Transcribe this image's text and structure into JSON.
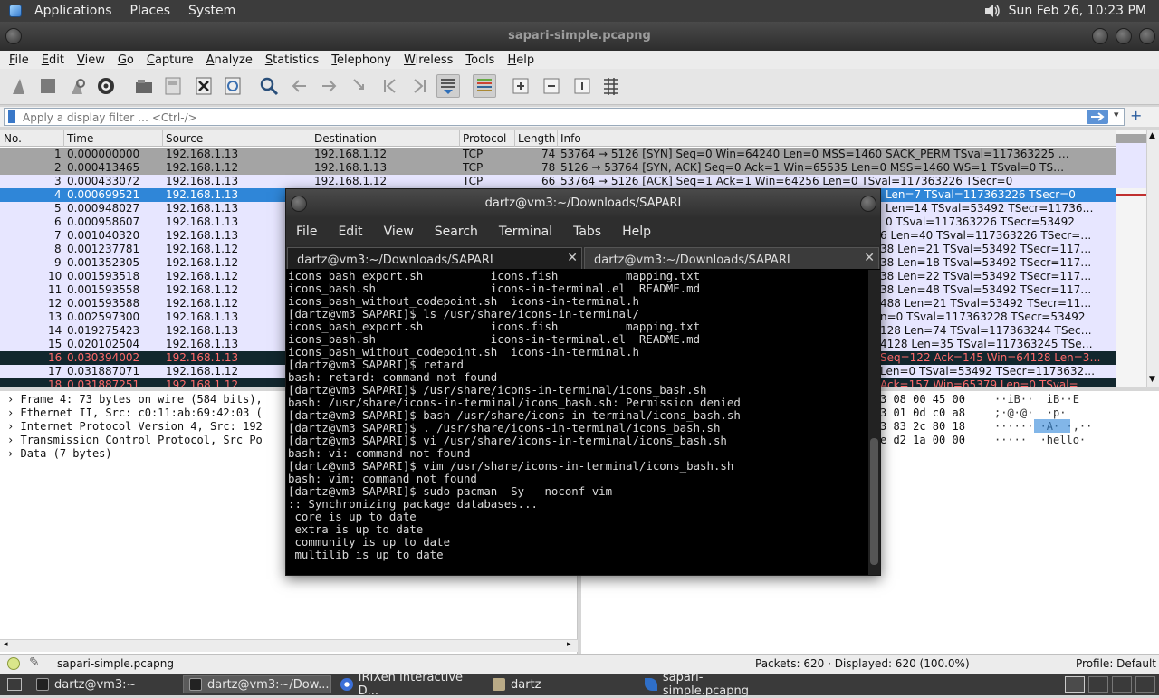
{
  "top_panel": {
    "menus": [
      "Applications",
      "Places",
      "System"
    ],
    "clock": "Sun Feb 26, 10:23 PM"
  },
  "wireshark": {
    "title": "sapari-simple.pcapng",
    "menus": [
      "File",
      "Edit",
      "View",
      "Go",
      "Capture",
      "Analyze",
      "Statistics",
      "Telephony",
      "Wireless",
      "Tools",
      "Help"
    ],
    "filter_placeholder": "Apply a display filter … <Ctrl-/>",
    "columns": [
      "No.",
      "Time",
      "Source",
      "Destination",
      "Protocol",
      "Length",
      "Info"
    ],
    "packets": [
      {
        "no": "1",
        "time": "0.000000000",
        "src": "192.168.1.13",
        "dst": "192.168.1.12",
        "proto": "TCP",
        "len": "74",
        "info": "53764 → 5126 [SYN] Seq=0 Win=64240 Len=0 MSS=1460 SACK_PERM TSval=117363225 …"
      },
      {
        "no": "2",
        "time": "0.000413465",
        "src": "192.168.1.12",
        "dst": "192.168.1.13",
        "proto": "TCP",
        "len": "78",
        "info": "5126 → 53764 [SYN, ACK] Seq=0 Ack=1 Win=65535 Len=0 MSS=1460 WS=1 TSval=0 TS…"
      },
      {
        "no": "3",
        "time": "0.000433072",
        "src": "192.168.1.13",
        "dst": "192.168.1.12",
        "proto": "TCP",
        "len": "66",
        "info": "53764 → 5126 [ACK] Seq=1 Ack=1 Win=64256 Len=0 TSval=117363226 TSecr=0"
      },
      {
        "no": "4",
        "time": "0.000699521",
        "src": "192.168.1.13",
        "dst": "",
        "proto": "",
        "len": "",
        "info": "Len=7 TSval=117363226 TSecr=0"
      },
      {
        "no": "5",
        "time": "0.000948027",
        "src": "192.168.1.13",
        "dst": "",
        "proto": "",
        "len": "",
        "info": "Len=14 TSval=53492 TSecr=11736…"
      },
      {
        "no": "6",
        "time": "0.000958607",
        "src": "192.168.1.13",
        "dst": "",
        "proto": "",
        "len": "",
        "info": "0 TSval=117363226 TSecr=53492"
      },
      {
        "no": "7",
        "time": "0.001040320",
        "src": "192.168.1.13",
        "dst": "",
        "proto": "",
        "len": "",
        "info": "6 Len=40 TSval=117363226 TSecr=…"
      },
      {
        "no": "8",
        "time": "0.001237781",
        "src": "192.168.1.12",
        "dst": "",
        "proto": "",
        "len": "",
        "info": "38 Len=21 TSval=53492 TSecr=117…"
      },
      {
        "no": "9",
        "time": "0.001352305",
        "src": "192.168.1.12",
        "dst": "",
        "proto": "",
        "len": "",
        "info": "38 Len=18 TSval=53492 TSecr=117…"
      },
      {
        "no": "10",
        "time": "0.001593518",
        "src": "192.168.1.12",
        "dst": "",
        "proto": "",
        "len": "",
        "info": "38 Len=22 TSval=53492 TSecr=117…"
      },
      {
        "no": "11",
        "time": "0.001593558",
        "src": "192.168.1.12",
        "dst": "",
        "proto": "",
        "len": "",
        "info": "38 Len=48 TSval=53492 TSecr=117…"
      },
      {
        "no": "12",
        "time": "0.001593588",
        "src": "192.168.1.12",
        "dst": "",
        "proto": "",
        "len": "",
        "info": "488 Len=21 TSval=53492 TSecr=11…"
      },
      {
        "no": "13",
        "time": "0.002597300",
        "src": "192.168.1.13",
        "dst": "",
        "proto": "",
        "len": "",
        "info": "n=0 TSval=117363228 TSecr=53492"
      },
      {
        "no": "14",
        "time": "0.019275423",
        "src": "192.168.1.13",
        "dst": "",
        "proto": "",
        "len": "",
        "info": "128 Len=74 TSval=117363244 TSec…"
      },
      {
        "no": "15",
        "time": "0.020102504",
        "src": "192.168.1.13",
        "dst": "",
        "proto": "",
        "len": "",
        "info": "4128 Len=35 TSval=117363245 TSe…"
      },
      {
        "no": "16",
        "time": "0.030394002",
        "src": "192.168.1.13",
        "dst": "",
        "proto": "",
        "len": "",
        "info": "Seq=122 Ack=145 Win=64128 Len=3…"
      },
      {
        "no": "17",
        "time": "0.031887071",
        "src": "192.168.1.12",
        "dst": "",
        "proto": "",
        "len": "",
        "info": "Len=0 TSval=53492 TSecr=1173632…"
      },
      {
        "no": "18",
        "time": "0.031887251",
        "src": "192.168.1.12",
        "dst": "",
        "proto": "",
        "len": "",
        "info": "Ack=157 Win=65379 Len=0 TSval=…"
      }
    ],
    "details": [
      "Frame 4: 73 bytes on wire (584 bits),",
      "Ethernet II, Src: c0:11:ab:69:42:03 (",
      "Internet Protocol Version 4, Src: 192",
      "Transmission Control Protocol, Src Po",
      "Data (7 bytes)"
    ],
    "bytes_hex": [
      "3 08 00 45 00",
      "3 01 0d c0 a8",
      "3 83 2c 80 18",
      "e d2 1a 00 00"
    ],
    "bytes_ascii": [
      "··iB··  iB··E",
      ";·@·@·  ·p·",
      "······ ·A· ·,··",
      "·····  ·hello·"
    ],
    "status_file": "sapari-simple.pcapng",
    "status_packets": "Packets: 620 · Displayed: 620 (100.0%)",
    "status_profile": "Profile: Default"
  },
  "terminal": {
    "title": "dartz@vm3:~/Downloads/SAPARI",
    "menus": [
      "File",
      "Edit",
      "View",
      "Search",
      "Terminal",
      "Tabs",
      "Help"
    ],
    "tabs": [
      "dartz@vm3:~/Downloads/SAPARI",
      "dartz@vm3:~/Downloads/SAPARI"
    ],
    "lines": [
      "icons_bash_export.sh          icons.fish          mapping.txt",
      "icons_bash.sh                 icons-in-terminal.el  README.md",
      "icons_bash_without_codepoint.sh  icons-in-terminal.h",
      "[dartz@vm3 SAPARI]$ ls /usr/share/icons-in-terminal/",
      "icons_bash_export.sh          icons.fish          mapping.txt",
      "icons_bash.sh                 icons-in-terminal.el  README.md",
      "icons_bash_without_codepoint.sh  icons-in-terminal.h",
      "[dartz@vm3 SAPARI]$ retard",
      "bash: retard: command not found",
      "[dartz@vm3 SAPARI]$ /usr/share/icons-in-terminal/icons_bash.sh",
      "bash: /usr/share/icons-in-terminal/icons_bash.sh: Permission denied",
      "[dartz@vm3 SAPARI]$ bash /usr/share/icons-in-terminal/icons_bash.sh",
      "[dartz@vm3 SAPARI]$ . /usr/share/icons-in-terminal/icons_bash.sh",
      "[dartz@vm3 SAPARI]$ vi /usr/share/icons-in-terminal/icons_bash.sh",
      "bash: vi: command not found",
      "[dartz@vm3 SAPARI]$ vim /usr/share/icons-in-terminal/icons_bash.sh",
      "bash: vim: command not found",
      "[dartz@vm3 SAPARI]$ sudo pacman -Sy --noconf vim",
      ":: Synchronizing package databases...",
      " core is up to date",
      " extra is up to date",
      " community is up to date",
      " multilib is up to date"
    ]
  },
  "taskbar": {
    "items": [
      "dartz@vm3:~",
      "dartz@vm3:~/Dow...",
      "IRIXen Interactive D...",
      "dartz",
      "sapari-simple.pcapng"
    ]
  },
  "colors": {
    "tcp_gray": "#a4a4a4",
    "lavender": "#e7e6ff",
    "selected": "#2f86d8",
    "black_row": "#12272e",
    "red_text": "#ff6b6b"
  }
}
